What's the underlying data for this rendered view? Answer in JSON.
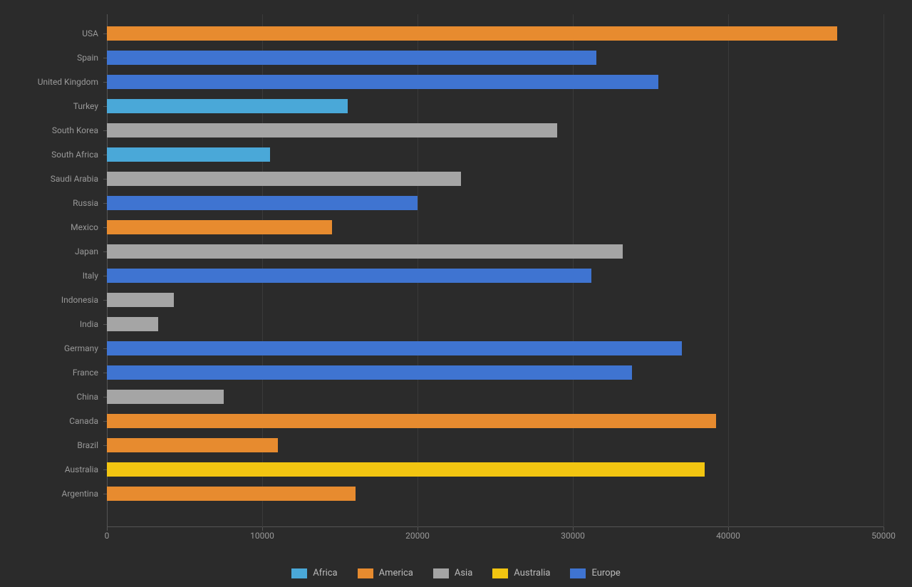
{
  "chart_data": {
    "type": "bar",
    "orientation": "horizontal",
    "xlim": [
      0,
      50000
    ],
    "xticks": [
      0,
      10000,
      20000,
      30000,
      40000,
      50000
    ],
    "categories": [
      "USA",
      "Spain",
      "United Kingdom",
      "Turkey",
      "South Korea",
      "South Africa",
      "Saudi Arabia",
      "Russia",
      "Mexico",
      "Japan",
      "Italy",
      "Indonesia",
      "India",
      "Germany",
      "France",
      "China",
      "Canada",
      "Brazil",
      "Australia",
      "Argentina"
    ],
    "values": [
      47000,
      31500,
      35500,
      15500,
      29000,
      10500,
      22800,
      20000,
      14500,
      33200,
      31200,
      4300,
      3300,
      37000,
      33800,
      7500,
      39200,
      11000,
      38500,
      16000
    ],
    "group_by": [
      "America",
      "Europe",
      "Europe",
      "Africa",
      "Asia",
      "Africa",
      "Asia",
      "Europe",
      "America",
      "Asia",
      "Europe",
      "Asia",
      "Asia",
      "Europe",
      "Europe",
      "Asia",
      "America",
      "America",
      "Australia",
      "America"
    ],
    "legend": [
      "Africa",
      "America",
      "Asia",
      "Australia",
      "Europe"
    ],
    "colors": {
      "Africa": "#4aa8d8",
      "America": "#e78b2f",
      "Asia": "#a5a5a5",
      "Australia": "#f2c511",
      "Europe": "#3f74d1"
    },
    "title": "",
    "xlabel": "",
    "ylabel": ""
  }
}
